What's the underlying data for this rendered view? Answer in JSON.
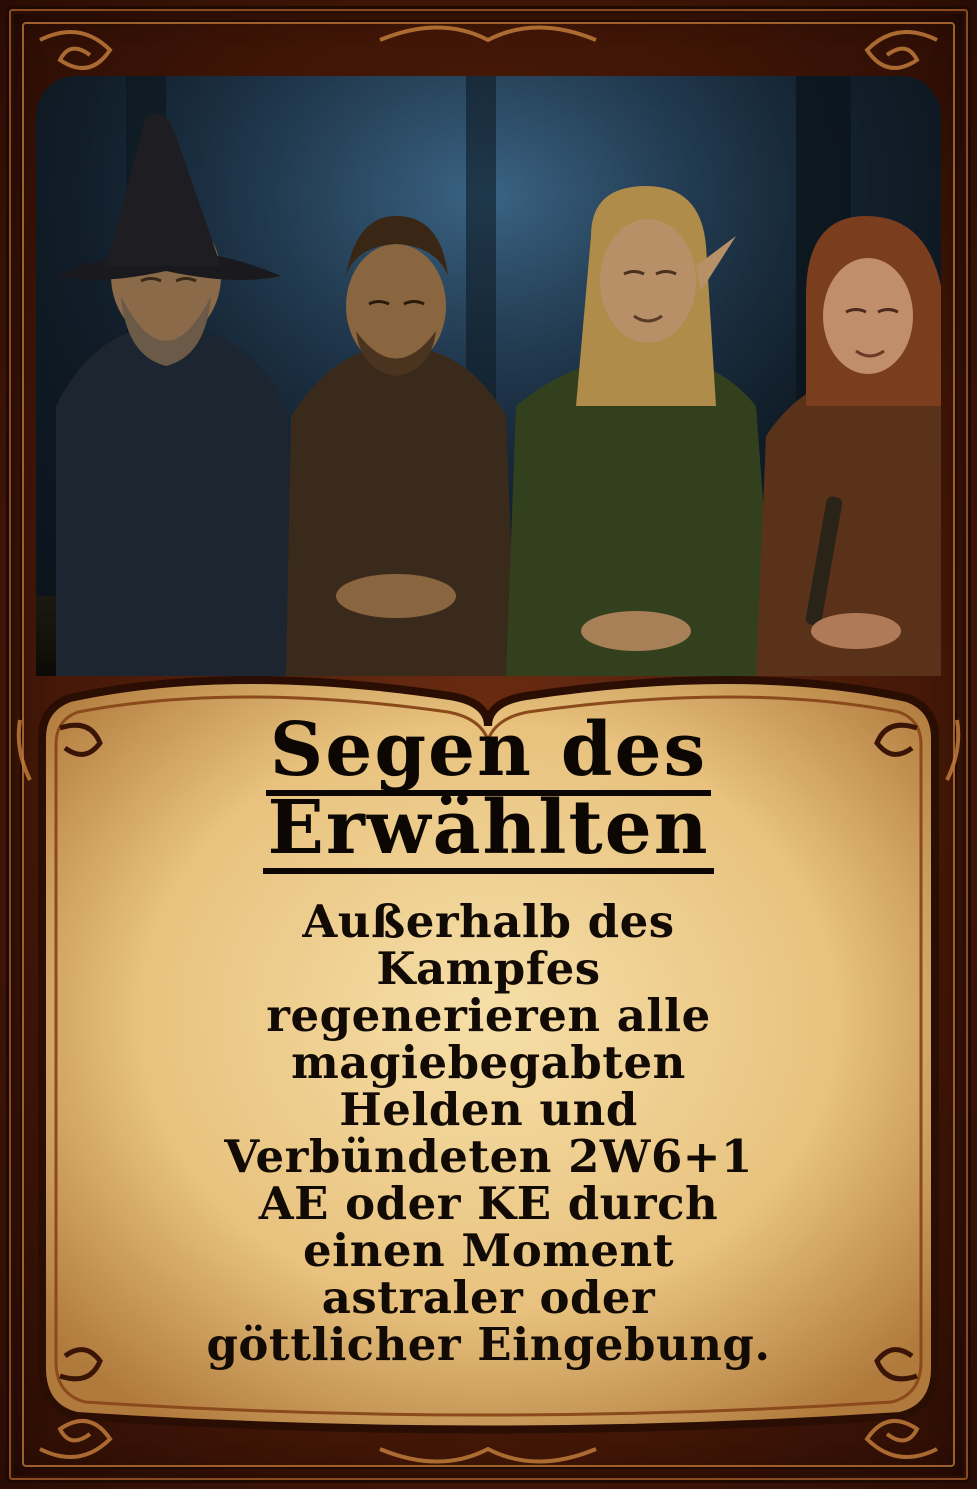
{
  "card": {
    "title_line1": "Segen des",
    "title_line2": "Erwählten",
    "description_lines": [
      "Außerhalb des",
      "Kampfes",
      "regenerieren alle",
      "magiebegabten",
      "Helden und",
      "Verbündeten 2W6+1",
      "AE oder KE durch",
      "einen Moment",
      "astraler oder",
      "göttlicher Eingebung."
    ],
    "artwork": "four-heroes-meditating",
    "colors": {
      "frame": "#4a1a08",
      "parchment": "#f2d49a",
      "text": "#0c0703"
    }
  }
}
